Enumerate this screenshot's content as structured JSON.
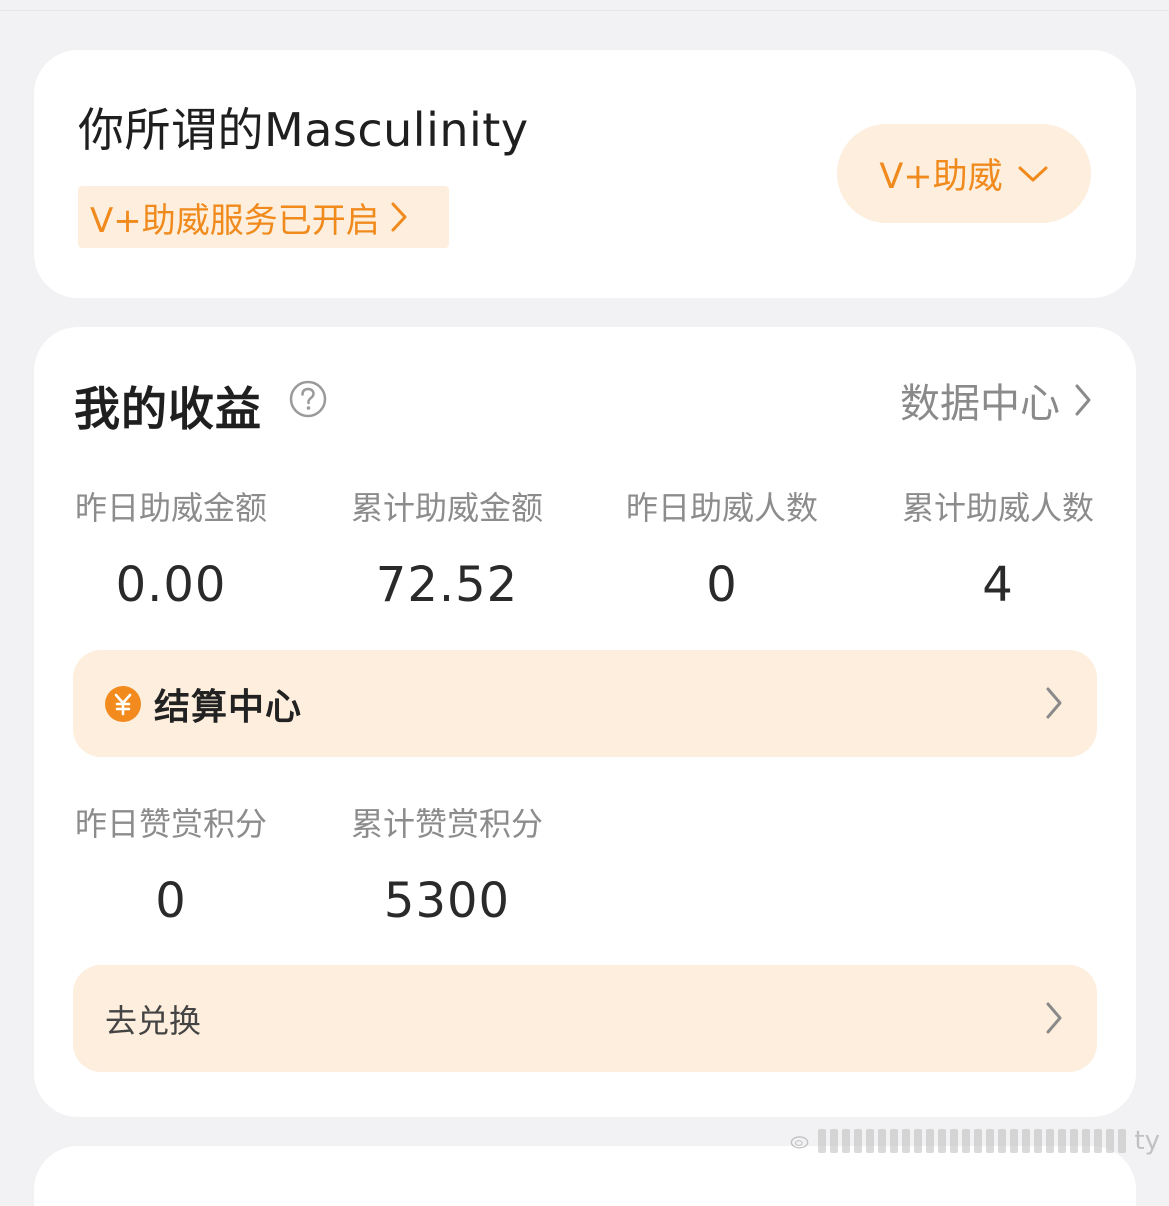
{
  "profile": {
    "name": "你所谓的Masculinity",
    "service_status": "V+助威服务已开启",
    "vplus_button": "V+助威"
  },
  "earnings": {
    "title": "我的收益",
    "data_center_link": "数据中心",
    "stats_row1": [
      {
        "label": "昨日助威金额",
        "value": "0.00"
      },
      {
        "label": "累计助威金额",
        "value": "72.52"
      },
      {
        "label": "昨日助威人数",
        "value": "0"
      },
      {
        "label": "累计助威人数",
        "value": "4"
      }
    ],
    "settlement_label": "结算中心",
    "stats_row2": [
      {
        "label": "昨日赞赏积分",
        "value": "0"
      },
      {
        "label": "累计赞赏积分",
        "value": "5300"
      }
    ],
    "exchange_label": "去兑换"
  },
  "watermark": {
    "text": "ty"
  },
  "colors": {
    "accent": "#f08a1c",
    "accent_bg": "#fdeedd",
    "page_bg": "#f2f2f4"
  }
}
